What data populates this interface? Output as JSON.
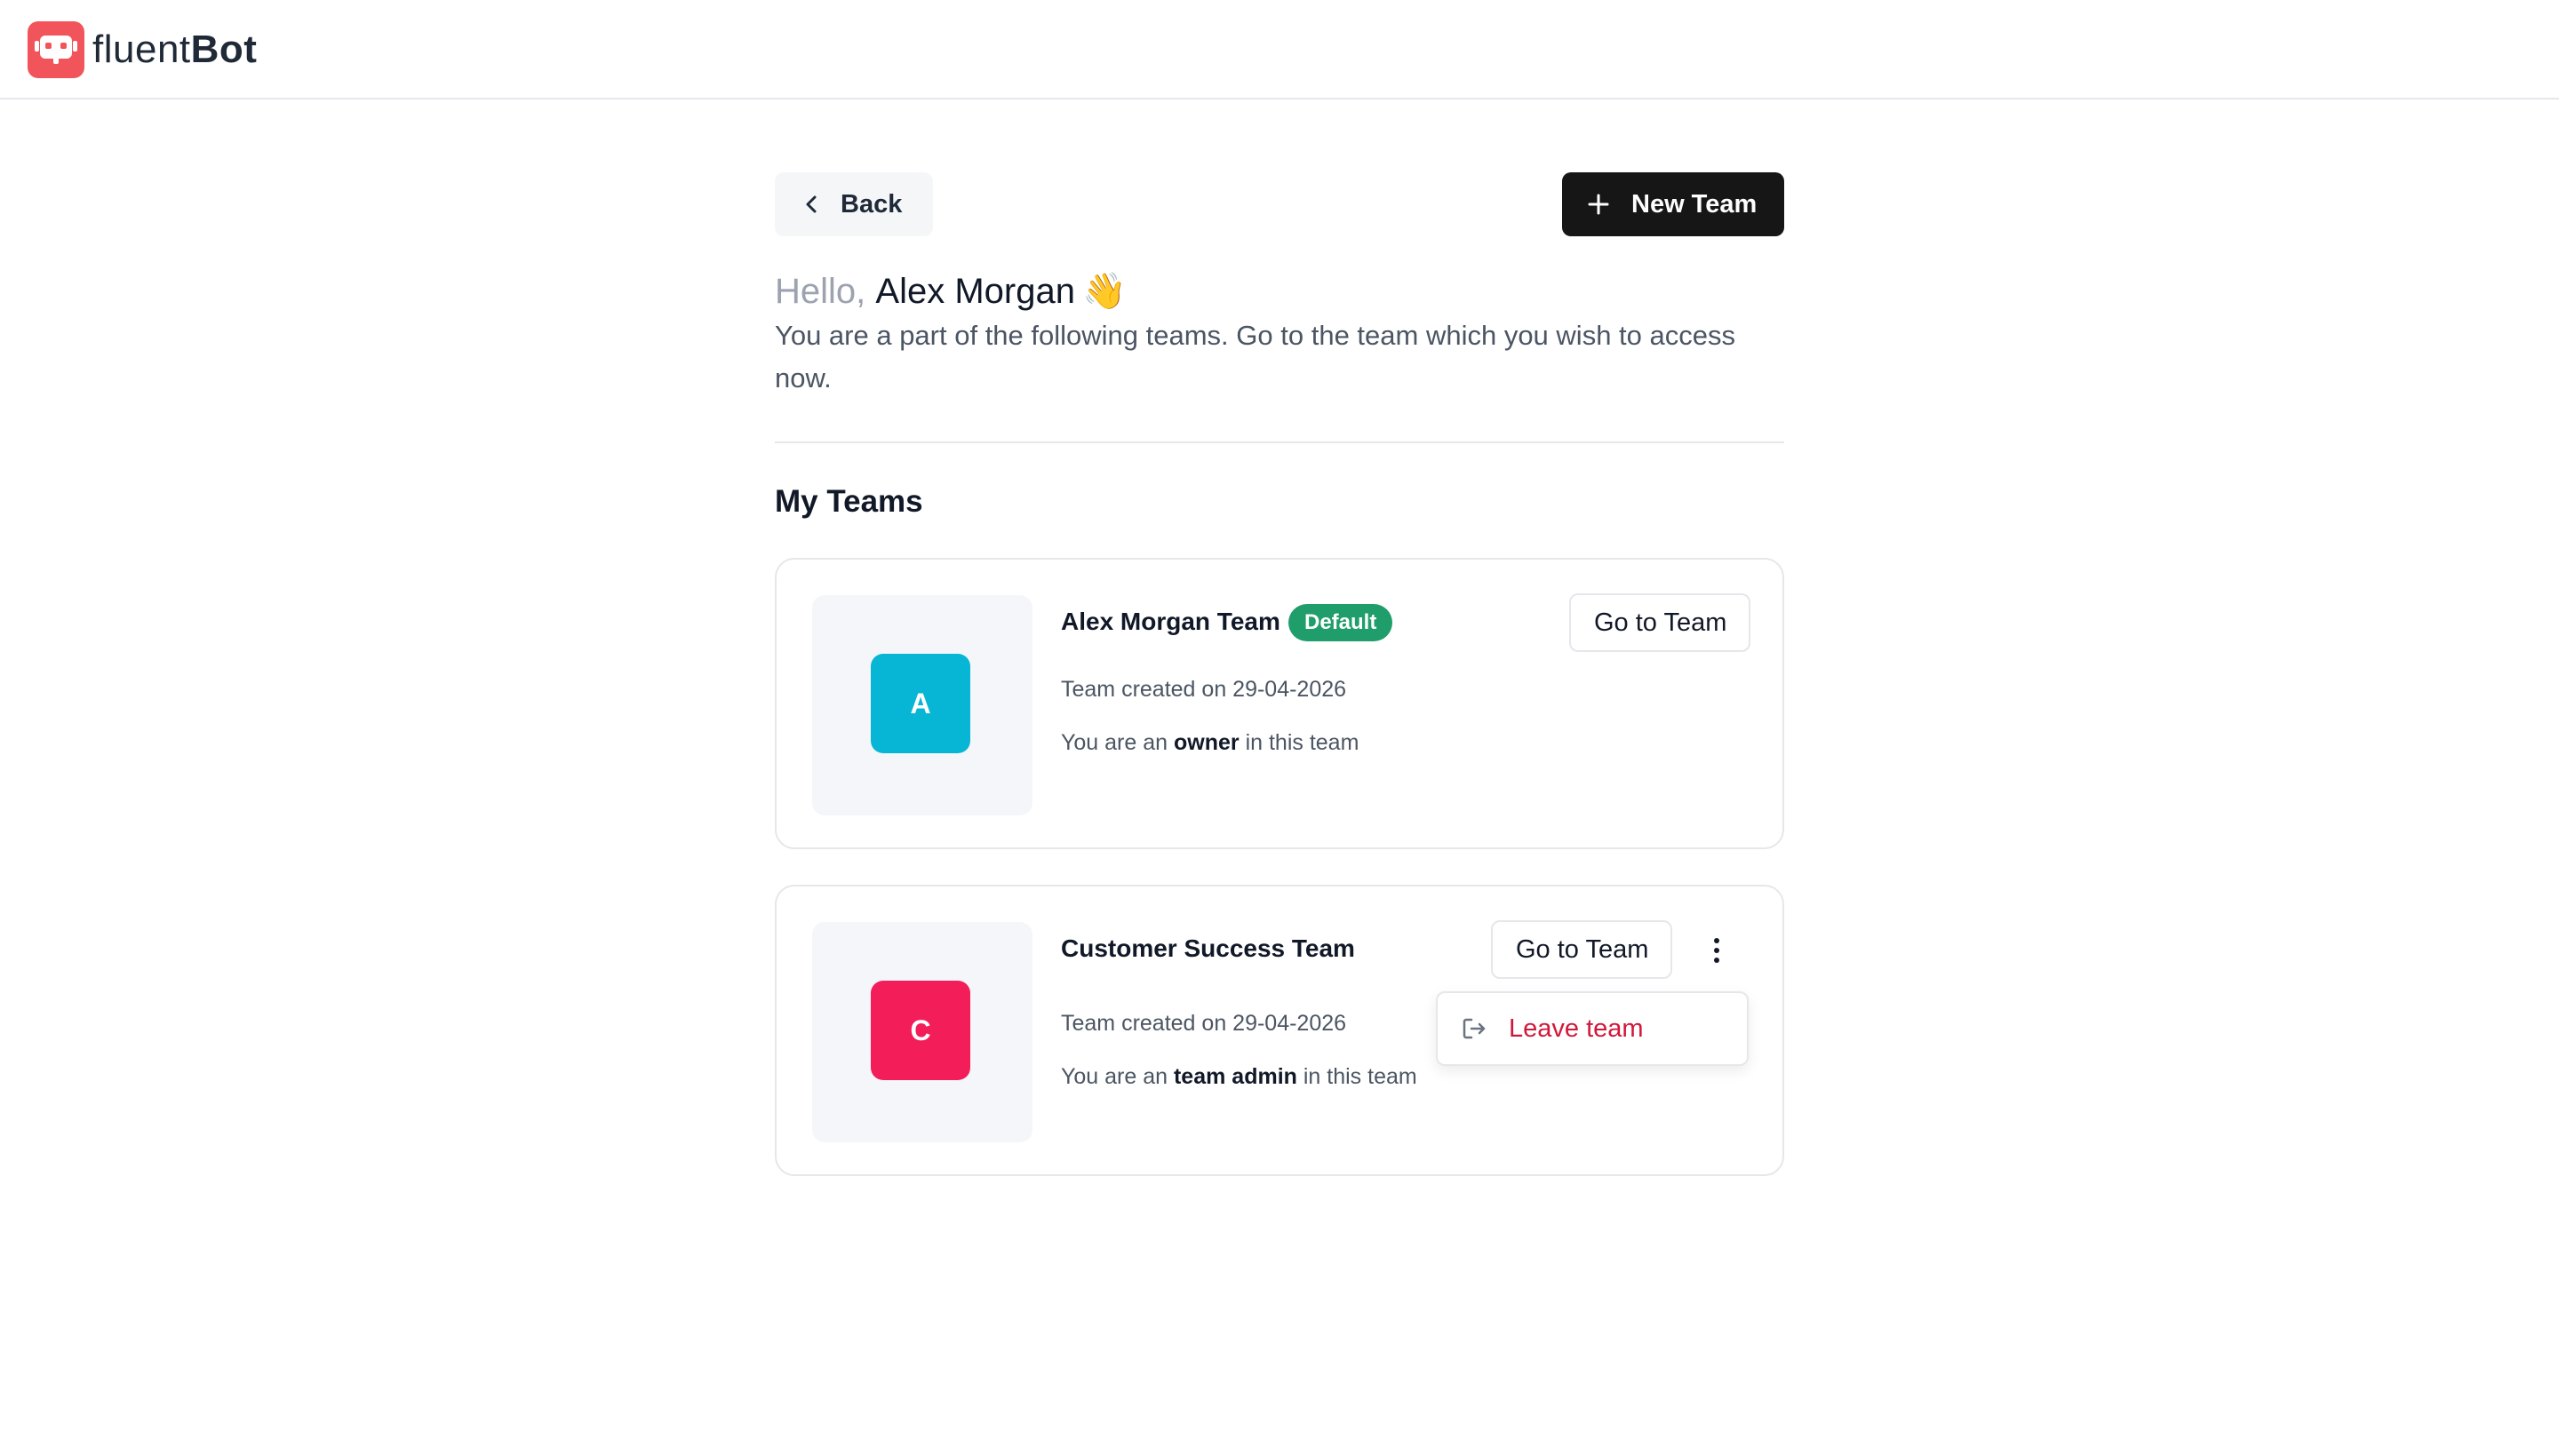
{
  "brand": {
    "name_light": "fluent",
    "name_bold": "Bot",
    "logo_icon": "robot-chat-icon",
    "accent": "#f2545b"
  },
  "toolbar": {
    "back_label": "Back",
    "new_team_label": "New Team"
  },
  "greeting": {
    "hello": "Hello,",
    "name": "Alex Morgan",
    "wave": "👋",
    "subtitle": "You are a part of the following teams. Go to the team which you wish to access now."
  },
  "section": {
    "title": "My Teams"
  },
  "teams": [
    {
      "initial": "A",
      "name": "Alex Morgan Team",
      "badge": "Default",
      "created": "Team created on 29-04-2026",
      "role_prefix": "You are an",
      "role": "owner",
      "role_suffix": "in this team",
      "goto_label": "Go to Team",
      "avatar_color": "#06b6d4"
    },
    {
      "initial": "C",
      "name": "Customer Success Team",
      "created": "Team created on 29-04-2026",
      "role_prefix": "You are an",
      "role": "team admin",
      "role_suffix": "in this team",
      "goto_label": "Go to Team",
      "avatar_color": "#f31d5a"
    }
  ],
  "dropdown": {
    "leave_label": "Leave team",
    "leave_color": "#d1183a"
  }
}
